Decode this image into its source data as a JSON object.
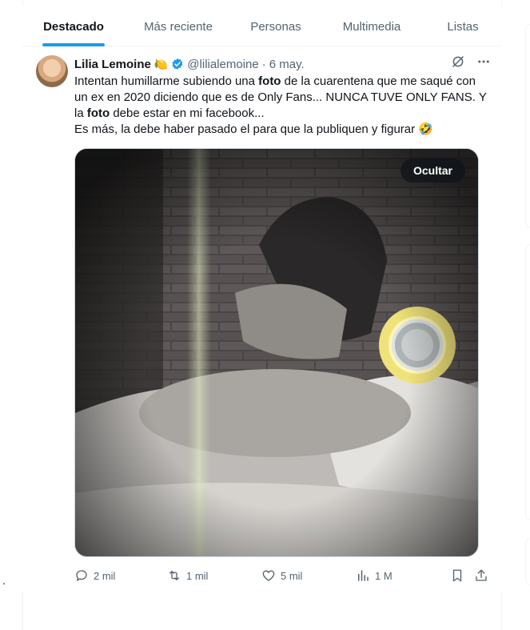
{
  "tabs": [
    {
      "label": "Destacado",
      "active": true
    },
    {
      "label": "Más reciente",
      "active": false
    },
    {
      "label": "Personas",
      "active": false
    },
    {
      "label": "Multimedia",
      "active": false
    },
    {
      "label": "Listas",
      "active": false
    }
  ],
  "tweet": {
    "name": "Lilia Lemoine",
    "name_emoji": "🍋",
    "handle": "@lilialemoine",
    "separator": "·",
    "date": "6 may.",
    "text_parts": [
      {
        "t": "Intentan humillarme subiendo una ",
        "bold": false
      },
      {
        "t": "foto",
        "bold": true
      },
      {
        "t": " de la cuarentena que me saqué con un ex en 2020 diciendo que es de Only Fans... NUNCA TUVE ONLY FANS. Y la ",
        "bold": false
      },
      {
        "t": "foto",
        "bold": true
      },
      {
        "t": " debe estar en mi facebook...",
        "bold": false
      },
      {
        "t": "\nEs más, la debe haber pasado el para que la publiquen y figurar 🤣",
        "bold": false
      }
    ],
    "media": {
      "hide_label": "Ocultar"
    },
    "stats": {
      "replies": "2 mil",
      "retweets": "1 mil",
      "likes": "5 mil",
      "views": "1 M"
    }
  },
  "icons": {
    "verified": "verified-badge-icon",
    "grok": "grok-icon",
    "more": "more-icon",
    "reply": "reply-icon",
    "retweet": "retweet-icon",
    "like": "heart-icon",
    "views": "views-icon",
    "bookmark": "bookmark-icon",
    "share": "share-icon"
  },
  "colors": {
    "accent": "#1d9bf0",
    "text": "#0f1419",
    "secondary": "#536471"
  },
  "stray_char": "."
}
